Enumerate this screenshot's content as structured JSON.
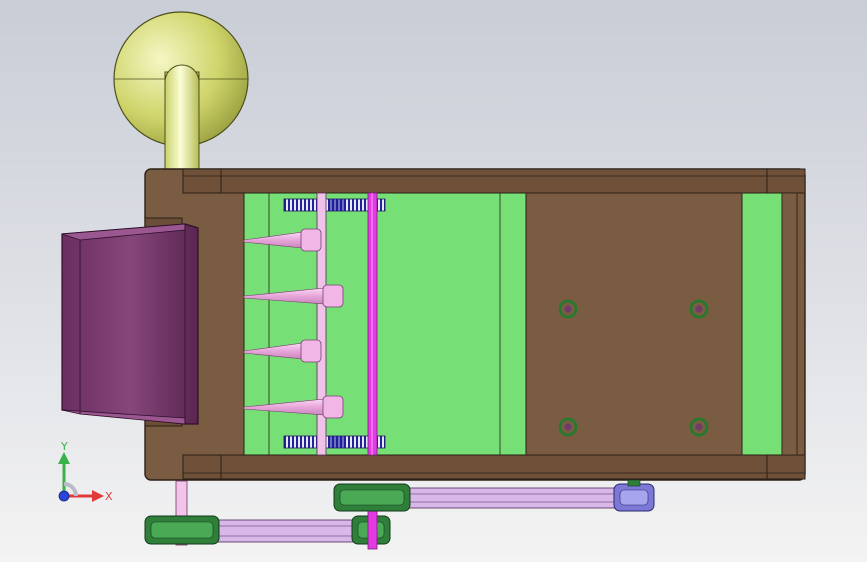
{
  "viewport": {
    "background": "#dcdfe5"
  },
  "model": {
    "colors": {
      "frame": "#7a5c42",
      "frame_edge": "#2b2017",
      "plate": "#76e076",
      "hopper": "#7e4172",
      "gear_hub": "#1c1c9a",
      "pink_part": "#f2b6e6",
      "magenta_shaft": "#e33be3",
      "fan_yellow": "#d7de7c",
      "pulley_green": "#2f7f3a",
      "belt": "#d8b8e8"
    }
  },
  "triad": {
    "x_label": "X",
    "y_label": "Y",
    "x_color": "#e03a3a",
    "y_color": "#39b14a",
    "z_color": "#2b45d6"
  }
}
